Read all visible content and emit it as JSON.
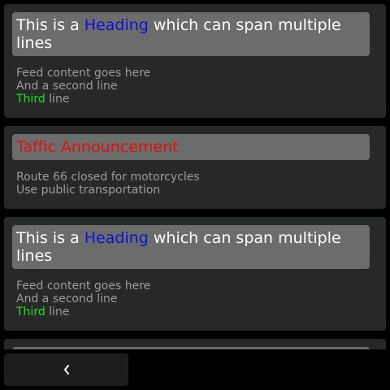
{
  "feed": {
    "items": [
      {
        "heading_pre": "This is a ",
        "heading_highlight": "Heading",
        "heading_post": " which can span multiple lines",
        "lines": [
          "Feed content goes here",
          "And a second line"
        ],
        "line3_highlight": "Third",
        "line3_rest": " line"
      },
      {
        "heading": "Taffic Announcement",
        "lines": [
          "Route 66 closed for motorcycles",
          "Use public transportation"
        ]
      },
      {
        "heading_pre": "This is a ",
        "heading_highlight": "Heading",
        "heading_post": " which can span multiple lines",
        "lines": [
          "Feed content goes here",
          "And a second line"
        ],
        "line3_highlight": "Third",
        "line3_rest": " line"
      }
    ]
  },
  "back_button": {
    "icon": "chevron-left-icon"
  },
  "colors": {
    "background": "#000000",
    "card": "#262928",
    "heading_bar": "#6a6d6b",
    "heading_highlight": "#1010d8",
    "alert": "#e0100f",
    "body_text": "#9b9d9c",
    "green_highlight": "#22e01a"
  }
}
